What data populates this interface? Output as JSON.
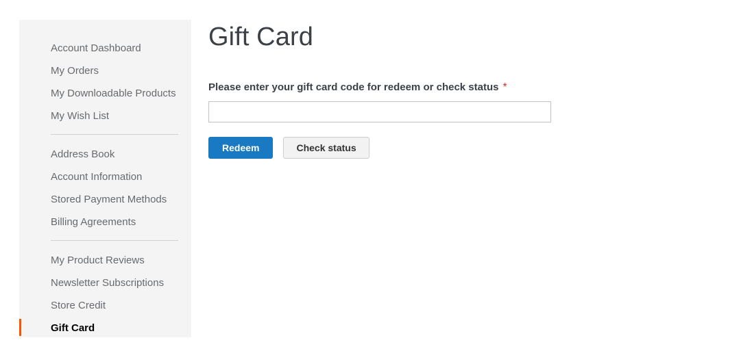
{
  "sidebar": {
    "groups": [
      {
        "items": [
          {
            "label": "Account Dashboard",
            "current": false
          },
          {
            "label": "My Orders",
            "current": false
          },
          {
            "label": "My Downloadable Products",
            "current": false
          },
          {
            "label": "My Wish List",
            "current": false
          }
        ]
      },
      {
        "items": [
          {
            "label": "Address Book",
            "current": false
          },
          {
            "label": "Account Information",
            "current": false
          },
          {
            "label": "Stored Payment Methods",
            "current": false
          },
          {
            "label": "Billing Agreements",
            "current": false
          }
        ]
      },
      {
        "items": [
          {
            "label": "My Product Reviews",
            "current": false
          },
          {
            "label": "Newsletter Subscriptions",
            "current": false
          },
          {
            "label": "Store Credit",
            "current": false
          },
          {
            "label": "Gift Card",
            "current": true
          }
        ]
      }
    ]
  },
  "main": {
    "page_title": "Gift Card",
    "form": {
      "field_label": "Please enter your gift card code for redeem or check status",
      "required_mark": "*",
      "code_value": "",
      "code_placeholder": ""
    },
    "actions": {
      "redeem_label": "Redeem",
      "check_status_label": "Check status"
    }
  },
  "colors": {
    "accent_orange": "#ff5501",
    "primary_blue": "#1979c3",
    "required_red": "#e02b27",
    "sidebar_bg": "#f4f4f4",
    "divider": "#d1d1d1"
  }
}
